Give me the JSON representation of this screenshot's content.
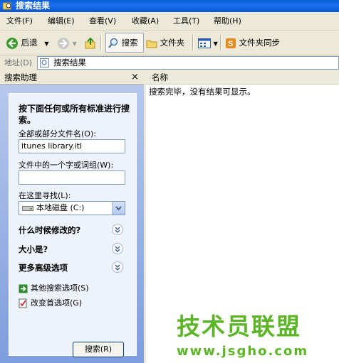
{
  "window": {
    "title": "搜索结果"
  },
  "menu": [
    "文件(F)",
    "编辑(E)",
    "查看(V)",
    "收藏(A)",
    "工具(T)",
    "帮助(H)"
  ],
  "toolbar": {
    "back": "后退",
    "search": "搜索",
    "folders": "文件夹",
    "sync": "文件夹同步"
  },
  "address": {
    "label": "地址(D)",
    "value": "搜索结果"
  },
  "assistant": {
    "pane_title": "搜索助理",
    "close": "×",
    "heading": "按下面任何或所有标准进行搜索。",
    "filename_label": "全部或部分文件名(O):",
    "filename_value": "itunes library.itl",
    "phrase_label": "文件中的一个字或词组(W):",
    "phrase_value": "",
    "lookin_label": "在这里寻找(L):",
    "lookin_value": "本地磁盘 (C:)",
    "when_modified": "什么时候修改的?",
    "size": "大小是?",
    "advanced": "更多高级选项",
    "other_options": "其他搜索选项(S)",
    "change_prefs": "改变首选项(G)",
    "search_button": "搜索(R)"
  },
  "results": {
    "column_name": "名称",
    "message": "搜索完毕，没有结果可显示。"
  },
  "watermark": {
    "text": "技术员联盟",
    "url": "www.jsgho.com"
  },
  "colors": {
    "title_bar": "#0a5fd8",
    "chrome": "#ece9d8",
    "assistant_bg": "#7f9ddd",
    "watermark": "#5bb526"
  }
}
